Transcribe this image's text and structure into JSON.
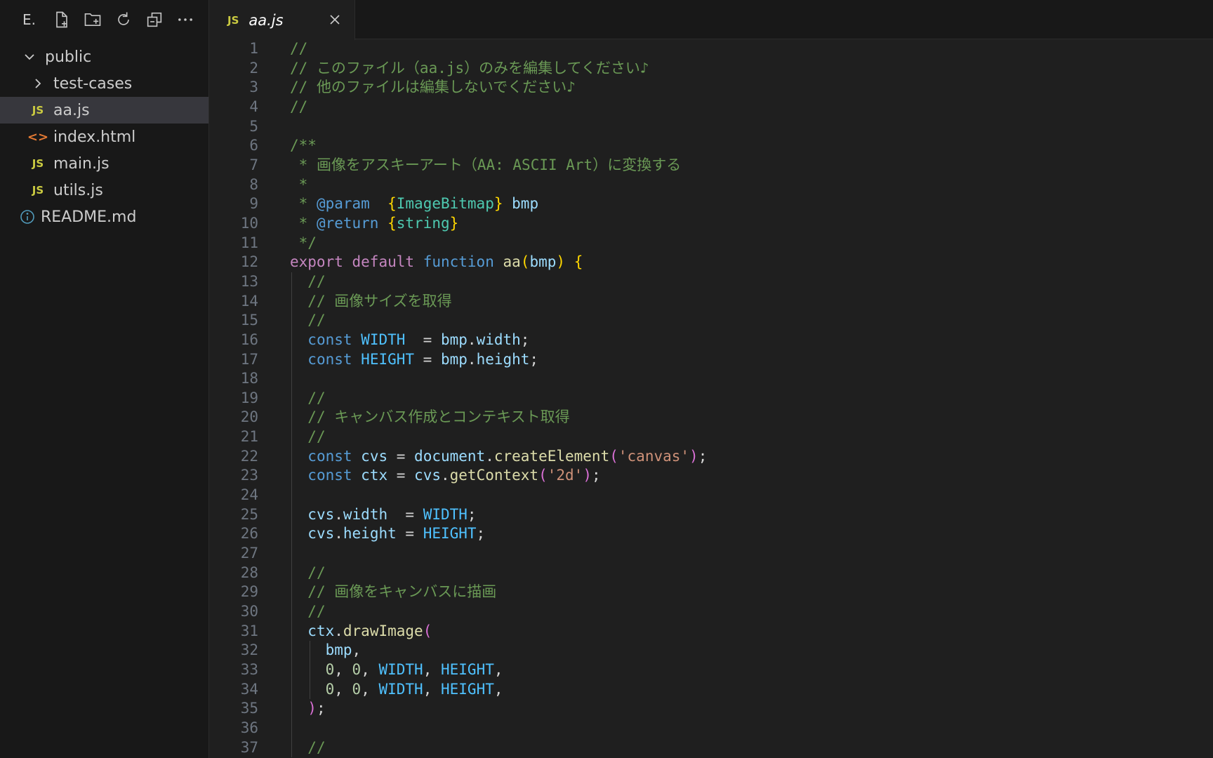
{
  "sidebar": {
    "header_label": "E.",
    "toolbar_icons": [
      "new-file-icon",
      "new-folder-icon",
      "refresh-icon",
      "collapse-all-icon",
      "more-icon"
    ],
    "tree": [
      {
        "label": "public",
        "type": "folder-open",
        "indent": 0
      },
      {
        "label": "test-cases",
        "type": "folder-closed",
        "indent": 1
      },
      {
        "label": "aa.js",
        "type": "js",
        "indent": 1,
        "selected": true
      },
      {
        "label": "index.html",
        "type": "html",
        "indent": 1
      },
      {
        "label": "main.js",
        "type": "js",
        "indent": 1
      },
      {
        "label": "utils.js",
        "type": "js",
        "indent": 1
      },
      {
        "label": "README.md",
        "type": "info",
        "indent": 0
      }
    ]
  },
  "tab": {
    "label": "aa.js",
    "icon_text": "JS"
  },
  "icon_text": {
    "js": "JS",
    "html": "<>"
  },
  "colors": {
    "comment": "#6a9955",
    "keyword": "#569cd6",
    "control": "#c586c0",
    "function": "#dcdcaa",
    "variable": "#9cdcfe",
    "constant": "#4fc1ff",
    "string": "#ce9178",
    "number": "#b5cea8",
    "type": "#4ec9b0",
    "bracket1": "#ffd700",
    "bracket2": "#da70d6"
  },
  "editor": {
    "lines": [
      [
        [
          "c-com",
          "//"
        ]
      ],
      [
        [
          "c-com",
          "// "
        ],
        [
          "c-com",
          "このファイル（aa.js）のみを編集してください♪"
        ]
      ],
      [
        [
          "c-com",
          "// "
        ],
        [
          "c-com",
          "他のファイルは編集しないでください♪"
        ]
      ],
      [
        [
          "c-com",
          "//"
        ]
      ],
      [],
      [
        [
          "c-com",
          "/**"
        ]
      ],
      [
        [
          "c-com",
          " * "
        ],
        [
          "c-com",
          "画像をアスキーアート（AA: ASCII Art）に変換する"
        ]
      ],
      [
        [
          "c-com",
          " *"
        ]
      ],
      [
        [
          "c-com",
          " * "
        ],
        [
          "c-kw",
          "@param "
        ],
        [
          "c-def",
          " "
        ],
        [
          "c-p1",
          "{"
        ],
        [
          "c-type",
          "ImageBitmap"
        ],
        [
          "c-p1",
          "}"
        ],
        [
          "c-def",
          " "
        ],
        [
          "c-var",
          "bmp"
        ]
      ],
      [
        [
          "c-com",
          " * "
        ],
        [
          "c-kw",
          "@return "
        ],
        [
          "c-p1",
          "{"
        ],
        [
          "c-type",
          "string"
        ],
        [
          "c-p1",
          "}"
        ]
      ],
      [
        [
          "c-com",
          " */"
        ]
      ],
      [
        [
          "c-ctl",
          "export"
        ],
        [
          "c-def",
          " "
        ],
        [
          "c-ctl",
          "default"
        ],
        [
          "c-def",
          " "
        ],
        [
          "c-kw",
          "function"
        ],
        [
          "c-def",
          " "
        ],
        [
          "c-fn",
          "aa"
        ],
        [
          "c-p1",
          "("
        ],
        [
          "c-var",
          "bmp"
        ],
        [
          "c-p1",
          ")"
        ],
        [
          "c-def",
          " "
        ],
        [
          "c-p1",
          "{"
        ]
      ],
      [
        [
          "c-def",
          "  "
        ],
        [
          "c-com",
          "//"
        ]
      ],
      [
        [
          "c-def",
          "  "
        ],
        [
          "c-com",
          "// "
        ],
        [
          "c-com",
          "画像サイズを取得"
        ]
      ],
      [
        [
          "c-def",
          "  "
        ],
        [
          "c-com",
          "//"
        ]
      ],
      [
        [
          "c-def",
          "  "
        ],
        [
          "c-kw",
          "const"
        ],
        [
          "c-def",
          " "
        ],
        [
          "c-const",
          "WIDTH"
        ],
        [
          "c-def",
          "  = "
        ],
        [
          "c-var",
          "bmp"
        ],
        [
          "c-def",
          "."
        ],
        [
          "c-var",
          "width"
        ],
        [
          "c-def",
          ";"
        ]
      ],
      [
        [
          "c-def",
          "  "
        ],
        [
          "c-kw",
          "const"
        ],
        [
          "c-def",
          " "
        ],
        [
          "c-const",
          "HEIGHT"
        ],
        [
          "c-def",
          " = "
        ],
        [
          "c-var",
          "bmp"
        ],
        [
          "c-def",
          "."
        ],
        [
          "c-var",
          "height"
        ],
        [
          "c-def",
          ";"
        ]
      ],
      [],
      [
        [
          "c-def",
          "  "
        ],
        [
          "c-com",
          "//"
        ]
      ],
      [
        [
          "c-def",
          "  "
        ],
        [
          "c-com",
          "// "
        ],
        [
          "c-com",
          "キャンバス作成とコンテキスト取得"
        ]
      ],
      [
        [
          "c-def",
          "  "
        ],
        [
          "c-com",
          "//"
        ]
      ],
      [
        [
          "c-def",
          "  "
        ],
        [
          "c-kw",
          "const"
        ],
        [
          "c-def",
          " "
        ],
        [
          "c-var",
          "cvs"
        ],
        [
          "c-def",
          " = "
        ],
        [
          "c-var",
          "document"
        ],
        [
          "c-def",
          "."
        ],
        [
          "c-fn",
          "createElement"
        ],
        [
          "c-p2",
          "("
        ],
        [
          "c-str",
          "'canvas'"
        ],
        [
          "c-p2",
          ")"
        ],
        [
          "c-def",
          ";"
        ]
      ],
      [
        [
          "c-def",
          "  "
        ],
        [
          "c-kw",
          "const"
        ],
        [
          "c-def",
          " "
        ],
        [
          "c-var",
          "ctx"
        ],
        [
          "c-def",
          " = "
        ],
        [
          "c-var",
          "cvs"
        ],
        [
          "c-def",
          "."
        ],
        [
          "c-fn",
          "getContext"
        ],
        [
          "c-p2",
          "("
        ],
        [
          "c-str",
          "'2d'"
        ],
        [
          "c-p2",
          ")"
        ],
        [
          "c-def",
          ";"
        ]
      ],
      [],
      [
        [
          "c-def",
          "  "
        ],
        [
          "c-var",
          "cvs"
        ],
        [
          "c-def",
          "."
        ],
        [
          "c-var",
          "width"
        ],
        [
          "c-def",
          "  = "
        ],
        [
          "c-const",
          "WIDTH"
        ],
        [
          "c-def",
          ";"
        ]
      ],
      [
        [
          "c-def",
          "  "
        ],
        [
          "c-var",
          "cvs"
        ],
        [
          "c-def",
          "."
        ],
        [
          "c-var",
          "height"
        ],
        [
          "c-def",
          " = "
        ],
        [
          "c-const",
          "HEIGHT"
        ],
        [
          "c-def",
          ";"
        ]
      ],
      [],
      [
        [
          "c-def",
          "  "
        ],
        [
          "c-com",
          "//"
        ]
      ],
      [
        [
          "c-def",
          "  "
        ],
        [
          "c-com",
          "// "
        ],
        [
          "c-com",
          "画像をキャンバスに描画"
        ]
      ],
      [
        [
          "c-def",
          "  "
        ],
        [
          "c-com",
          "//"
        ]
      ],
      [
        [
          "c-def",
          "  "
        ],
        [
          "c-var",
          "ctx"
        ],
        [
          "c-def",
          "."
        ],
        [
          "c-fn",
          "drawImage"
        ],
        [
          "c-p2",
          "("
        ]
      ],
      [
        [
          "c-def",
          "    "
        ],
        [
          "c-var",
          "bmp"
        ],
        [
          "c-def",
          ","
        ]
      ],
      [
        [
          "c-def",
          "    "
        ],
        [
          "c-num",
          "0"
        ],
        [
          "c-def",
          ", "
        ],
        [
          "c-num",
          "0"
        ],
        [
          "c-def",
          ", "
        ],
        [
          "c-const",
          "WIDTH"
        ],
        [
          "c-def",
          ", "
        ],
        [
          "c-const",
          "HEIGHT"
        ],
        [
          "c-def",
          ","
        ]
      ],
      [
        [
          "c-def",
          "    "
        ],
        [
          "c-num",
          "0"
        ],
        [
          "c-def",
          ", "
        ],
        [
          "c-num",
          "0"
        ],
        [
          "c-def",
          ", "
        ],
        [
          "c-const",
          "WIDTH"
        ],
        [
          "c-def",
          ", "
        ],
        [
          "c-const",
          "HEIGHT"
        ],
        [
          "c-def",
          ","
        ]
      ],
      [
        [
          "c-def",
          "  "
        ],
        [
          "c-p2",
          ")"
        ],
        [
          "c-def",
          ";"
        ]
      ],
      [],
      [
        [
          "c-def",
          "  "
        ],
        [
          "c-com",
          "//"
        ]
      ]
    ]
  }
}
